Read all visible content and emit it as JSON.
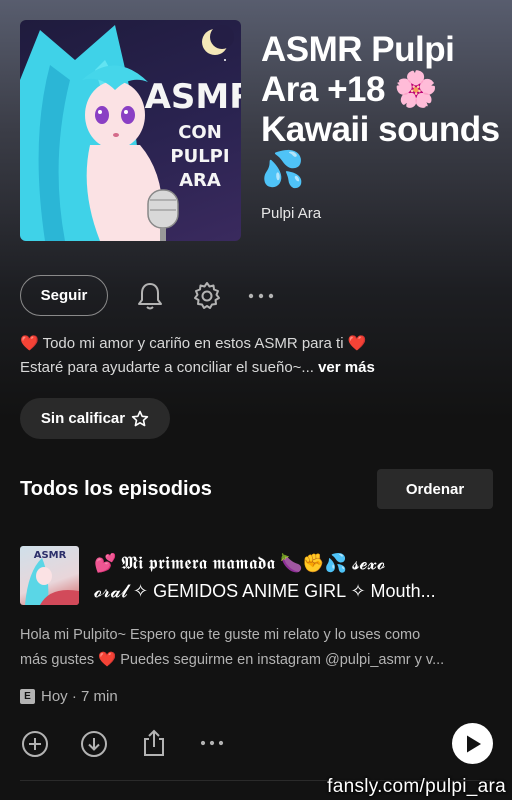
{
  "podcast": {
    "title": "ASMR Pulpi Ara +18 🌸 Kawaii sounds 💦",
    "author": "Pulpi Ara",
    "cover_text": [
      "ASMR",
      "CON",
      "PULPI",
      "ARA"
    ]
  },
  "actions": {
    "follow_label": "Seguir",
    "bell_icon": "bell-icon",
    "settings_icon": "gear-icon",
    "more_icon": "more-horizontal-icon"
  },
  "description": {
    "line1": "❤️ Todo mi amor y cariño en estos ASMR para ti ❤️",
    "line2": "Estaré para ayudarte a conciliar el sueño~...",
    "more_label": "ver más"
  },
  "rating": {
    "label": "Sin calificar",
    "icon": "star-outline-icon"
  },
  "episodes_section": {
    "title": "Todos los episodios",
    "sort_label": "Ordenar"
  },
  "episode": {
    "thumb_text": "ASMR",
    "title_line1": "💕 𝕸𝖎 𝖕𝖗𝖎𝖒𝖊𝖗𝖆 𝖒𝖆𝖒𝖆𝖉𝖆 🍆✊💦 𝓼𝓮𝔁𝓸",
    "title_line2": "𝓸𝓻𝓪𝓵 ✧ GEMIDOS ANIME GIRL ✧ Mouth...",
    "desc_line1": "Hola mi Pulpito~ Espero que te guste mi relato y lo uses como",
    "desc_line2": "más gustes ❤️ Puedes seguirme en instagram @pulpi_asmr y v...",
    "explicit_badge": "E",
    "meta": "Hoy · 7 min",
    "icons": [
      "add-circle-icon",
      "download-circle-icon",
      "share-icon",
      "more-horizontal-icon",
      "play-icon"
    ]
  },
  "watermark": "fansly.com/pulpi_ara",
  "colors": {
    "background": "#121212",
    "accent_white": "#ffffff",
    "muted_text": "#b3b3b3",
    "button_dark": "#2a2a2a"
  }
}
